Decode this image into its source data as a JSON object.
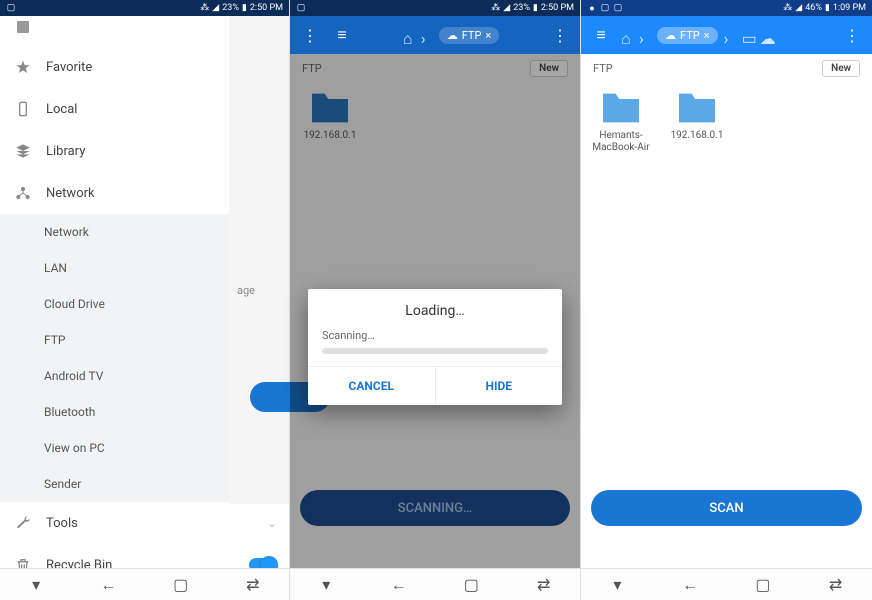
{
  "status": {
    "left_icons": [
      "image-icon"
    ],
    "right_text1": "23%",
    "right_time1": "2:50 PM",
    "right_text3": "46%",
    "right_time3": "1:09 PM"
  },
  "sidebar": {
    "truncated_label": "",
    "items": [
      {
        "label": "Favorite",
        "icon": "star"
      },
      {
        "label": "Local",
        "icon": "phone"
      },
      {
        "label": "Library",
        "icon": "layers"
      },
      {
        "label": "Network",
        "icon": "network",
        "expanded": true
      }
    ],
    "network_sub": [
      "Network",
      "LAN",
      "Cloud Drive",
      "FTP",
      "Android TV",
      "Bluetooth",
      "View on PC",
      "Sender"
    ],
    "tools": "Tools",
    "recycle": "Recycle Bin",
    "peek": "age"
  },
  "p2": {
    "crumb_chip": "FTP",
    "tab": "FTP",
    "new": "New",
    "folders": [
      {
        "label": "192.168.0.1"
      }
    ],
    "button": "SCANNING…",
    "dialog": {
      "title": "Loading…",
      "subtitle": "Scanning…",
      "cancel": "CANCEL",
      "hide": "HIDE"
    }
  },
  "p3": {
    "crumb_chip": "FTP",
    "tab": "FTP",
    "new": "New",
    "folders": [
      {
        "label": "Hemants-MacBook-Air"
      },
      {
        "label": "192.168.0.1"
      }
    ],
    "button": "SCAN"
  }
}
